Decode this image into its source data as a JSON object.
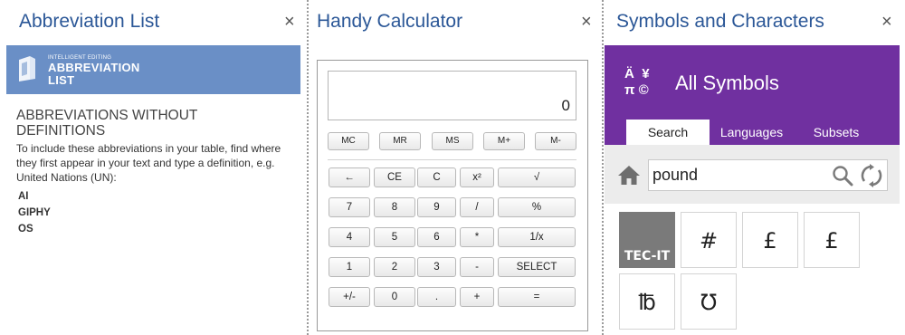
{
  "abbreviation": {
    "title": "Abbreviation List",
    "close": "×",
    "banner_small": "INTELLIGENT EDITING",
    "banner_line1": "ABBREVIATION",
    "banner_line2": "LIST",
    "heading": "ABBREVIATIONS WITHOUT DEFINITIONS",
    "description": "To include these abbreviations in your table, find where they first appear in your text and type a definition, e.g. United Nations (UN):",
    "items": [
      "AI",
      "GIPHY",
      "OS"
    ]
  },
  "calculator": {
    "title": "Handy Calculator",
    "close": "×",
    "display": "0",
    "memory_buttons": [
      "MC",
      "MR",
      "MS",
      "M+",
      "M-"
    ],
    "rows": [
      [
        "←",
        "CE",
        "C",
        "x²",
        "√"
      ],
      [
        "7",
        "8",
        "9",
        "/",
        "%"
      ],
      [
        "4",
        "5",
        "6",
        "*",
        "1/x"
      ],
      [
        "1",
        "2",
        "3",
        "-",
        "SELECT"
      ],
      [
        "+/-",
        "0",
        ".",
        "+",
        "="
      ]
    ]
  },
  "symbols": {
    "title": "Symbols and Characters",
    "close": "×",
    "header_glyphs": [
      "Ä",
      "¥",
      "π",
      "©"
    ],
    "header_title": "All Symbols",
    "tabs": [
      "Search",
      "Languages",
      "Subsets"
    ],
    "active_tab": "Search",
    "search_value": "pound",
    "logo_text": "TEC-IT",
    "results": [
      "#",
      "£",
      "£",
      "℔",
      "℧"
    ],
    "accent_color": "#7030a0"
  }
}
